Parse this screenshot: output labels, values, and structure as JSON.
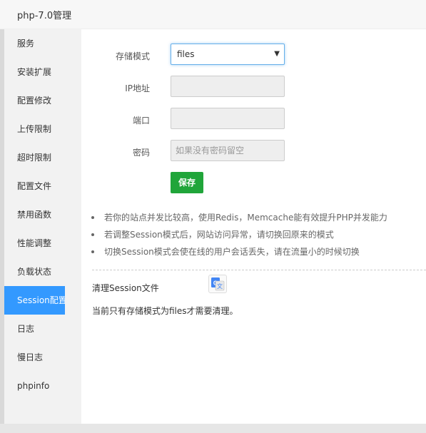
{
  "window": {
    "title": "php-7.0管理"
  },
  "sidebar": {
    "items": [
      {
        "label": "服务"
      },
      {
        "label": "安装扩展"
      },
      {
        "label": "配置修改"
      },
      {
        "label": "上传限制"
      },
      {
        "label": "超时限制"
      },
      {
        "label": "配置文件"
      },
      {
        "label": "禁用函数"
      },
      {
        "label": "性能调整"
      },
      {
        "label": "负载状态"
      },
      {
        "label": "Session配置",
        "active": true
      },
      {
        "label": "日志"
      },
      {
        "label": "慢日志"
      },
      {
        "label": "phpinfo"
      }
    ]
  },
  "form": {
    "storage_mode_label": "存储模式",
    "storage_mode_value": "files",
    "ip_label": "IP地址",
    "ip_value": "",
    "port_label": "端口",
    "port_value": "",
    "password_label": "密码",
    "password_placeholder": "如果没有密码留空",
    "save_label": "保存"
  },
  "tips": [
    "若你的站点并发比较高，使用Redis，Memcache能有效提升PHP并发能力",
    "若调整Session模式后，网站访问异常，请切换回原来的模式",
    "切换Session模式会使在线的用户会话丢失，请在流量小的时候切换"
  ],
  "clean": {
    "label": "清理Session文件",
    "status": "当前只有存储模式为files才需要清理。"
  },
  "colors": {
    "accent": "#3399ff",
    "save_button": "#20a53a",
    "sidebar_bg": "#f2f2f2"
  },
  "icons": {
    "translate": "google-translate-icon",
    "dropdown": "chevron-down-icon"
  }
}
